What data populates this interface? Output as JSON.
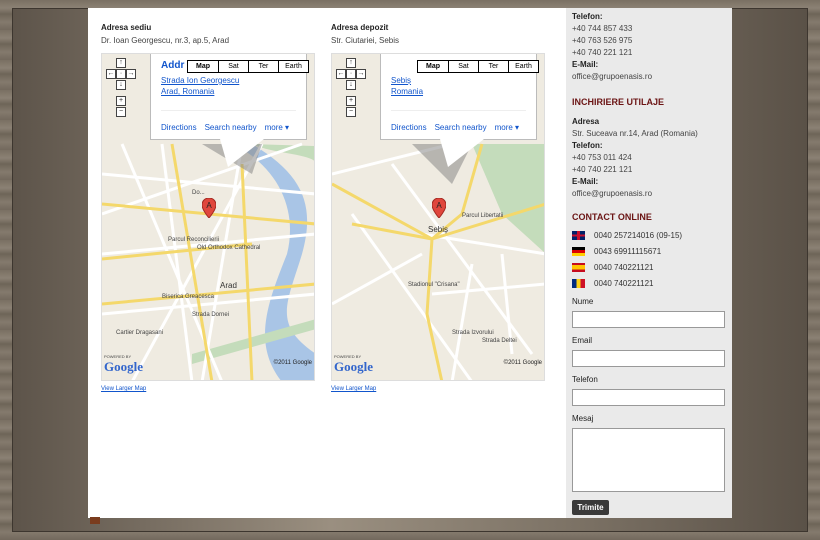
{
  "left_address": {
    "title": "Adresa sediu",
    "text": "Dr. Ioan Georgescu, nr.3, ap.5, Arad",
    "map": {
      "popup_title": "Addr",
      "popup_line1": "Strada Ion Georgescu",
      "popup_line2": "Arad, Romania",
      "labels": [
        "Strada Revolutiei",
        "Strada Andrei Saguna",
        "Strada Dornei",
        "Parcul Reconcilierii",
        "Old Orthodox Cathedral",
        "Arad",
        "Cartier Dragasani",
        "Biserica Greacesca",
        "Calea Romanilor",
        "Cartier Micalaca",
        "Do..."
      ]
    },
    "view_larger": "View Larger Map"
  },
  "right_address": {
    "title": "Adresa depozit",
    "text": "Str. Ciutariei, Sebis",
    "map": {
      "popup_title": "Addr",
      "popup_line1": "Sebiș",
      "popup_line2": "Romania",
      "labels": [
        "Sebiș",
        "Parcul Libertatii",
        "Stadionul \"Crisana\"",
        "Strada Oituzului",
        "Bulevardul Revolutiei",
        "Strada Crisului",
        "Strada Izvorului",
        "Strada Deltei",
        "Strada Morii",
        "Strada Aradului",
        "Strada Viilor"
      ]
    },
    "view_larger": "View Larger Map"
  },
  "map_common": {
    "types": [
      "Map",
      "Sat",
      "Ter",
      "Earth"
    ],
    "actions": [
      "Directions",
      "Search nearby",
      "more ▾"
    ],
    "copyright": "©2011 Google",
    "powered_by": "POWERED BY",
    "google": "Google"
  },
  "sidebar": {
    "top": {
      "telefon_label": "Telefon:",
      "phones": [
        "+40 744 857 433",
        "+40 763 526 975",
        "+40 740 221 121"
      ],
      "email_label": "E-Mail:",
      "email": "office@grupoenasis.ro"
    },
    "rental": {
      "heading": "INCHIRIERE UTILAJE",
      "adresa_label": "Adresa",
      "adresa": "Str. Suceava nr.14, Arad (Romania)",
      "telefon_label": "Telefon:",
      "phones": [
        "+40 753 011 424",
        "+40 740 221 121"
      ],
      "email_label": "E-Mail:",
      "email": "office@grupoenasis.ro"
    },
    "contact": {
      "heading": "CONTACT ONLINE",
      "languages": [
        {
          "flag": "uk-flag-icon",
          "number": "0040 257214016 (09-15)"
        },
        {
          "flag": "germany-flag-icon",
          "number": "0043 69911115671"
        },
        {
          "flag": "spain-flag-icon",
          "number": "0040 740221121"
        },
        {
          "flag": "romania-flag-icon",
          "number": "0040 740221121"
        }
      ]
    },
    "form": {
      "name_label": "Nume",
      "email_label": "Email",
      "phone_label": "Telefon",
      "message_label": "Mesaj",
      "submit": "Trimite"
    }
  }
}
